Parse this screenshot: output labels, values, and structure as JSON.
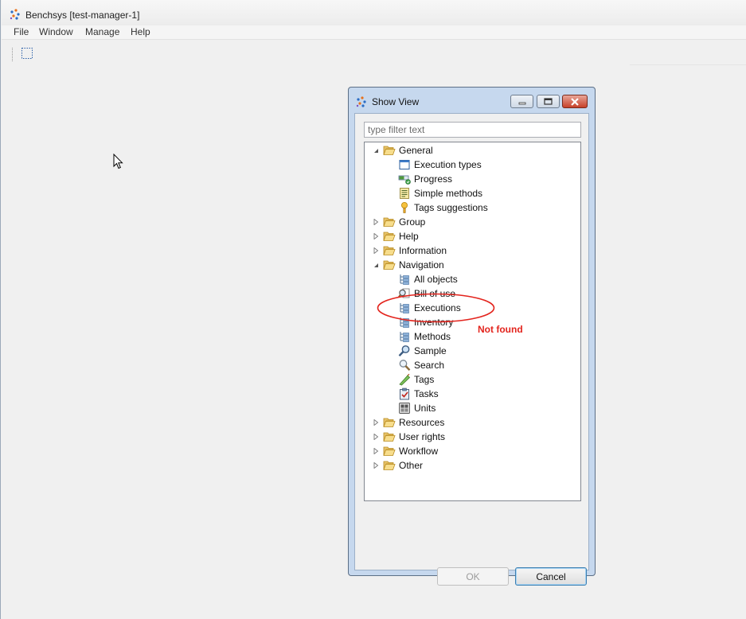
{
  "app": {
    "title": "Benchsys [test-manager-1]",
    "menu": [
      "File",
      "Window",
      "Manage",
      "Help"
    ]
  },
  "dialog": {
    "title": "Show View",
    "filter_placeholder": "type filter text",
    "ok_label": "OK",
    "cancel_label": "Cancel",
    "tree": {
      "general": {
        "label": "General",
        "expanded": true
      },
      "execution_types": {
        "label": "Execution types",
        "icon": "view-window-icon"
      },
      "progress": {
        "label": "Progress",
        "icon": "progress-icon"
      },
      "simple_methods": {
        "label": "Simple methods",
        "icon": "list-document-icon"
      },
      "tags_suggestions": {
        "label": "Tags suggestions",
        "icon": "lightbulb-icon"
      },
      "group": {
        "label": "Group",
        "expanded": false
      },
      "help": {
        "label": "Help",
        "expanded": false
      },
      "information": {
        "label": "Information",
        "expanded": false
      },
      "navigation": {
        "label": "Navigation",
        "expanded": true
      },
      "all_objects": {
        "label": "All objects",
        "icon": "tree-list-icon"
      },
      "bill_of_use": {
        "label": "Bill of use",
        "icon": "magnifier-document-icon"
      },
      "executions": {
        "label": "Executions",
        "icon": "tree-list-icon"
      },
      "inventory": {
        "label": "Inventory",
        "icon": "tree-list-icon"
      },
      "methods": {
        "label": "Methods",
        "icon": "tree-list-icon"
      },
      "sample": {
        "label": "Sample",
        "icon": "magnifier-icon"
      },
      "search": {
        "label": "Search",
        "icon": "search-icon"
      },
      "tags": {
        "label": "Tags",
        "icon": "tag-icon"
      },
      "tasks": {
        "label": "Tasks",
        "icon": "clipboard-icon"
      },
      "units": {
        "label": "Units",
        "icon": "units-icon"
      },
      "resources": {
        "label": "Resources",
        "expanded": false
      },
      "user_rights": {
        "label": "User rights",
        "expanded": false
      },
      "workflow": {
        "label": "Workflow",
        "expanded": false
      },
      "other": {
        "label": "Other",
        "expanded": false
      }
    }
  },
  "annotation": {
    "text": "Not found",
    "color": "#e3241d"
  }
}
